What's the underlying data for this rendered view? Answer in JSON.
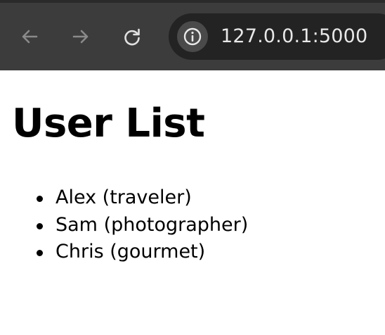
{
  "browser": {
    "url": "127.0.0.1:5000",
    "icons": {
      "back": "arrow-left-icon",
      "forward": "arrow-right-icon",
      "reload": "reload-icon",
      "site_info": "info-icon"
    },
    "colors": {
      "toolbar": "#3c3c3c",
      "omnibox": "#232323",
      "url_text": "#e8e8e8",
      "icon_disabled": "#8a8a8a"
    }
  },
  "page": {
    "heading": "User List",
    "users": [
      {
        "text": "Alex (traveler)"
      },
      {
        "text": "Sam (photographer)"
      },
      {
        "text": "Chris (gourmet)"
      }
    ]
  }
}
